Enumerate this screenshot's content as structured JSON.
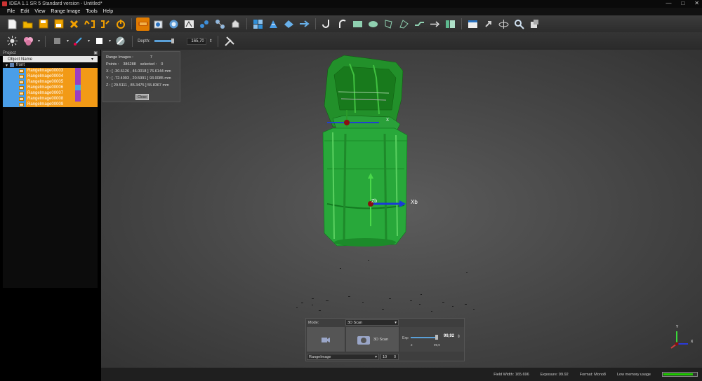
{
  "window": {
    "title": "IDEA 1.1 SR 5 Standard version - Untitled*",
    "controls": [
      "—",
      "□",
      "✕"
    ]
  },
  "menu": [
    "File",
    "Edit",
    "View",
    "Range Image",
    "Tools",
    "Help"
  ],
  "toolbar_icons": [
    "new-icon",
    "open-folder-icon",
    "save-icon",
    "save-as-icon",
    "delete-icon",
    "undo-icon",
    "redo-icon",
    "power-icon",
    "scan-tool-icon",
    "align-icon",
    "rotate-icon",
    "merge-icon",
    "points-icon",
    "measure-icon",
    "object-icon",
    "grid-icon",
    "mesh-icon",
    "bird-icon",
    "arrow-icon",
    "hook-icon",
    "curve-icon",
    "rect-icon",
    "ellipse-icon",
    "lasso-icon",
    "poly-icon",
    "line-icon",
    "arrow-right-icon",
    "panel-icon",
    "window-icon",
    "pin-icon",
    "orbit-icon",
    "zoom-icon",
    "cube-icon"
  ],
  "toolbar2": {
    "depth_label": "Depth:",
    "depth_value": "165,70"
  },
  "project": {
    "title": "Project",
    "column": "Object Name",
    "root": "front",
    "items": [
      {
        "label": "RangeImage00003",
        "color": "#9b3fc2"
      },
      {
        "label": "RangeImage00004",
        "color": "#9b3fc2"
      },
      {
        "label": "RangeImage00005",
        "color": "#9b3fc2"
      },
      {
        "label": "RangeImage00006",
        "color": "#4aa8e0"
      },
      {
        "label": "RangeImage00007",
        "color": "#9b3fc2"
      },
      {
        "label": "RangeImage00008",
        "color": "#9b3fc2"
      },
      {
        "label": "RangeImage00009",
        "color": "#f29a16"
      }
    ]
  },
  "info_panel": {
    "title": "Range Images :",
    "title_value": "7",
    "points_label": "Points :",
    "points_value": "386288",
    "selected_label": "selected :",
    "selected_value": "0",
    "x_line": "X : [ -30.6126 , 46.0018 ]  76.6144 mm",
    "y_line": "Y : [ -72.4093 , 20.5991 ]  93.0085 mm",
    "z_line": "Z : [ 29.5111 , 85.3475 ]  55.8367 mm",
    "close": "Close"
  },
  "axes": {
    "x_upper": "X",
    "z_label": "Zb",
    "x_label": "Xb"
  },
  "scan_panel": {
    "mode_label": "Mode:",
    "mode_value": "3D Scan",
    "scan_button": "3D Scan",
    "exp_label": "Exp",
    "exp_value": "99,92",
    "exp_min": "2",
    "exp_max": "99,9",
    "range_select": "RangeImage",
    "range_count": "10"
  },
  "orientation": {
    "y": "Y",
    "x": "X"
  },
  "status": {
    "field_width": "Field Width: 165.696",
    "exposure": "Exposure: 99.92",
    "format": "Format: Mono8",
    "memory": "Low memory usage",
    "memory_level": 0.85
  }
}
